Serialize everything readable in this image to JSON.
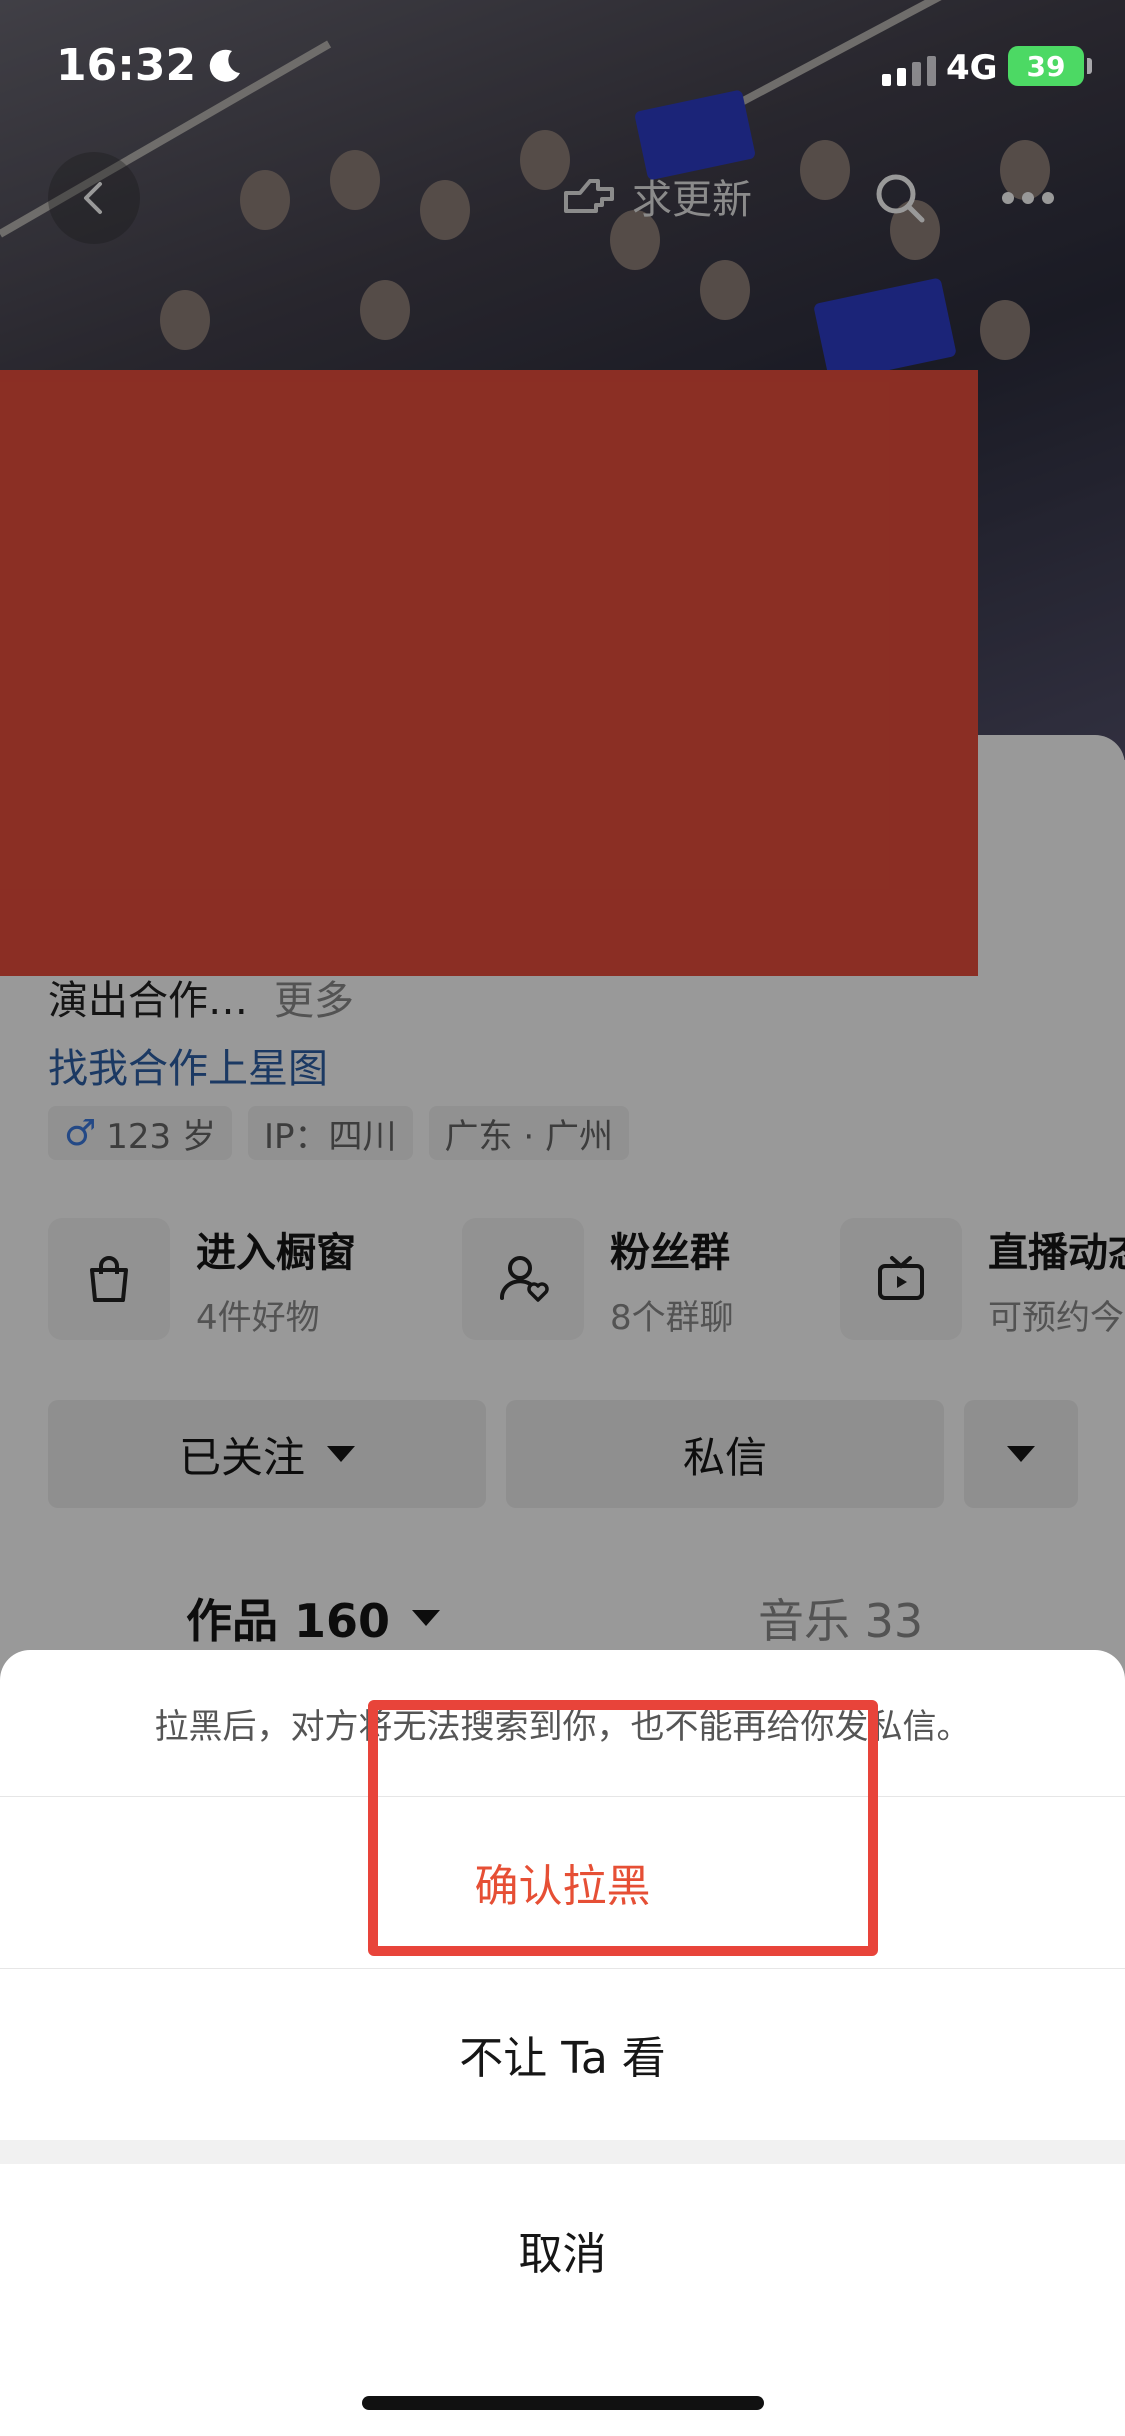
{
  "status_bar": {
    "time": "16:32",
    "network": "4G",
    "battery": "39"
  },
  "top_nav": {
    "update_label": "求更新"
  },
  "profile": {
    "bio": "演出合作…",
    "more_label": "更多",
    "star_link": "找我合作上星图",
    "tags": {
      "gender_age": "123 岁",
      "ip": "IP：四川",
      "location": "广东 · 广州"
    },
    "features": [
      {
        "title": "进入橱窗",
        "sub": "4件好物",
        "icon": "shopping-bag-icon"
      },
      {
        "title": "粉丝群",
        "sub": "8个群聊",
        "icon": "fan-group-icon"
      },
      {
        "title": "直播动态",
        "sub": "可预约今",
        "icon": "tv-icon"
      }
    ],
    "follow_label": "已关注",
    "message_label": "私信",
    "tabs": {
      "works": "作品 160",
      "music": "音乐 33"
    }
  },
  "sheet": {
    "message": "拉黑后，对方将无法搜索到你，也不能再给你发私信。",
    "confirm_label": "确认拉黑",
    "hide_label": "不让 Ta 看",
    "cancel_label": "取消"
  },
  "colors": {
    "confirm": "#e64f35",
    "highlight_box": "#e8443a",
    "redaction": "#e84e3c",
    "link": "#2e5fa6"
  }
}
